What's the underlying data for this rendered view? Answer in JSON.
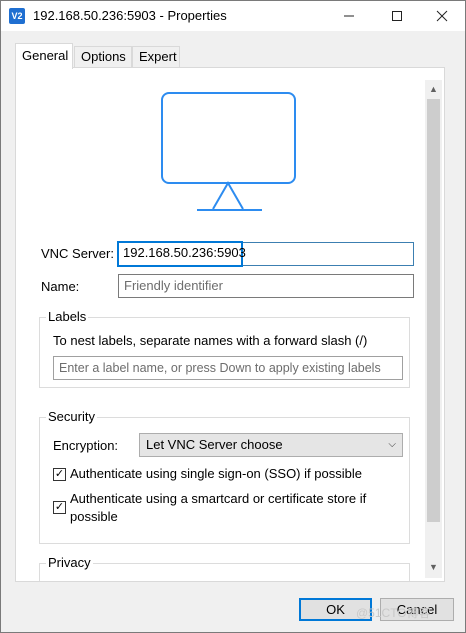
{
  "window": {
    "title": "192.168.50.236:5903 - Properties",
    "app_icon_text": "V2"
  },
  "tabs": [
    {
      "label": "General",
      "active": true
    },
    {
      "label": "Options",
      "active": false
    },
    {
      "label": "Expert",
      "active": false
    }
  ],
  "general": {
    "vnc_server_label": "VNC Server:",
    "vnc_server_value": "192.168.50.236:5903",
    "name_label": "Name:",
    "name_placeholder": "Friendly identifier",
    "labels": {
      "title": "Labels",
      "hint": "To nest labels, separate names with a forward slash (/)",
      "input_placeholder": "Enter a label name, or press Down to apply existing labels"
    },
    "security": {
      "title": "Security",
      "encryption_label": "Encryption:",
      "encryption_value": "Let VNC Server choose",
      "sso_label": "Authenticate using single sign-on (SSO) if possible",
      "sso_checked": true,
      "smartcard_label_line1": "Authenticate using a smartcard or certificate store if",
      "smartcard_label_line2": "possible",
      "smartcard_checked": true
    },
    "privacy": {
      "title": "Privacy"
    }
  },
  "buttons": {
    "ok": "OK",
    "cancel": "Cancel"
  },
  "watermark": "@51CTO博客",
  "colors": {
    "accent": "#0078d7",
    "monitor_stroke": "#2d8cf0"
  }
}
